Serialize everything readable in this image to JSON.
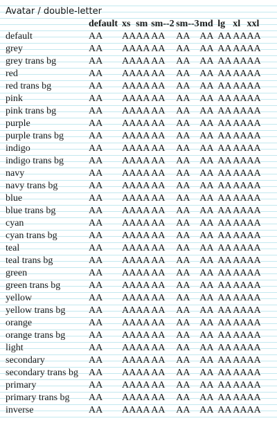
{
  "title": "Avatar / double-letter",
  "columns": [
    "default",
    "xs",
    "sm",
    "sm--2",
    "sm--3",
    "md",
    "lg",
    "xl",
    "xxl"
  ],
  "avatar_text": "AA",
  "rows": [
    "default",
    "grey",
    "grey trans bg",
    "red",
    "red trans bg",
    "pink",
    "pink trans bg",
    "purple",
    "purple trans bg",
    "indigo",
    "indigo trans bg",
    "navy",
    "navy trans bg",
    "blue",
    "blue trans bg",
    "cyan",
    "cyan trans bg",
    "teal",
    "teal trans bg",
    "green",
    "green trans bg",
    "yellow",
    "yellow trans bg",
    "orange",
    "orange trans bg",
    "light",
    "secondary",
    "secondary trans bg",
    "primary",
    "primary trans bg",
    "inverse"
  ],
  "colors": {
    "rule_line": "#c2e8ef",
    "text": "#1a1a1a",
    "background": "#ffffff"
  }
}
